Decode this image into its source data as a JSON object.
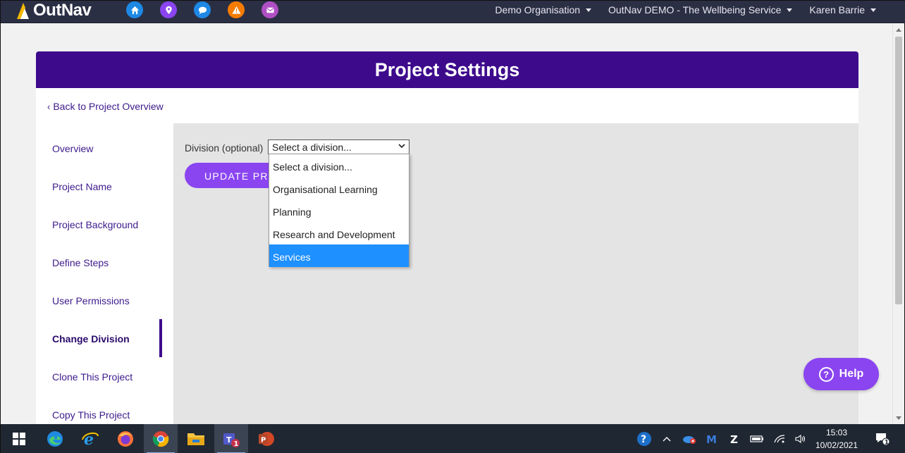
{
  "app": {
    "logo_text": "OutNav"
  },
  "topnav": {
    "organisation": "Demo Organisation",
    "project": "OutNav DEMO - The Wellbeing Service",
    "user": "Karen Barrie",
    "icons": [
      {
        "name": "home-icon",
        "color": "#1e88e5"
      },
      {
        "name": "location-pin-icon",
        "color": "#8a45f0"
      },
      {
        "name": "chat-icon",
        "color": "#1e88e5"
      },
      {
        "name": "warning-icon",
        "color": "#f57c00"
      },
      {
        "name": "mail-icon",
        "color": "#b04fc4"
      }
    ]
  },
  "page": {
    "title": "Project Settings",
    "back_link": "Back to Project Overview"
  },
  "sidebar": {
    "items": [
      {
        "label": "Overview"
      },
      {
        "label": "Project Name"
      },
      {
        "label": "Project Background"
      },
      {
        "label": "Define Steps"
      },
      {
        "label": "User Permissions"
      },
      {
        "label": "Change Division",
        "active": true
      },
      {
        "label": "Clone This Project"
      },
      {
        "label": "Copy This Project"
      }
    ]
  },
  "form": {
    "division_label": "Division (optional)",
    "division_value": "Select a division...",
    "update_button": "UPDATE PROJECT",
    "dropdown_options": [
      "Select a division...",
      "Organisational Learning",
      "Planning",
      "Research and Development",
      "Services"
    ],
    "highlighted_option": "Services"
  },
  "help": {
    "label": "Help"
  },
  "taskbar": {
    "time": "15:03",
    "date": "10/02/2021",
    "teams_badge": "1",
    "notification_badge": "1",
    "powerpoint_letter": "P",
    "teams_letter": "T",
    "malwarebytes_letter": "M",
    "zoom_letter": "Z"
  },
  "colors": {
    "nav_bg": "#2b2f44",
    "header_purple": "#3d0a8c",
    "button_purple": "#8a45f0",
    "option_highlight": "#1e90ff"
  }
}
